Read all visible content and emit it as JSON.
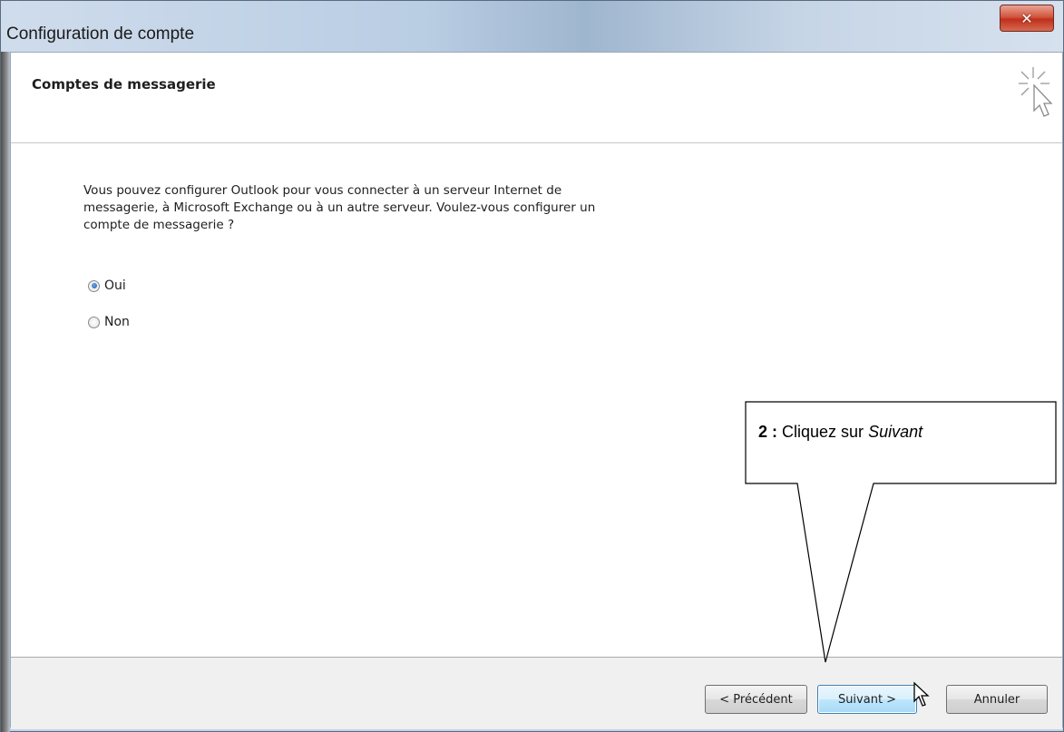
{
  "window": {
    "title": "Configuration de compte",
    "close_glyph": "✕"
  },
  "header": {
    "title": "Comptes de messagerie",
    "icon": "wizard-cursor-sparkle-icon"
  },
  "main": {
    "intro_lines": [
      "Vous pouvez configurer Outlook pour vous connecter à un serveur Internet de",
      "messagerie, à Microsoft Exchange ou à un autre serveur. Voulez-vous configurer un",
      "compte de messagerie ?"
    ],
    "options": [
      {
        "label": "Oui",
        "checked": true
      },
      {
        "label": "Non",
        "checked": false
      }
    ]
  },
  "footer": {
    "back_label": "< Précédent",
    "next_label": "Suivant >",
    "cancel_label": "Annuler"
  },
  "callout": {
    "step": "2 :",
    "text": " Cliquez sur ",
    "emphasis": "Suivant"
  },
  "colors": {
    "close_red": "#c0301b",
    "focus_blue": "#3c7fb1",
    "radio_blue": "#1c5bb5"
  }
}
